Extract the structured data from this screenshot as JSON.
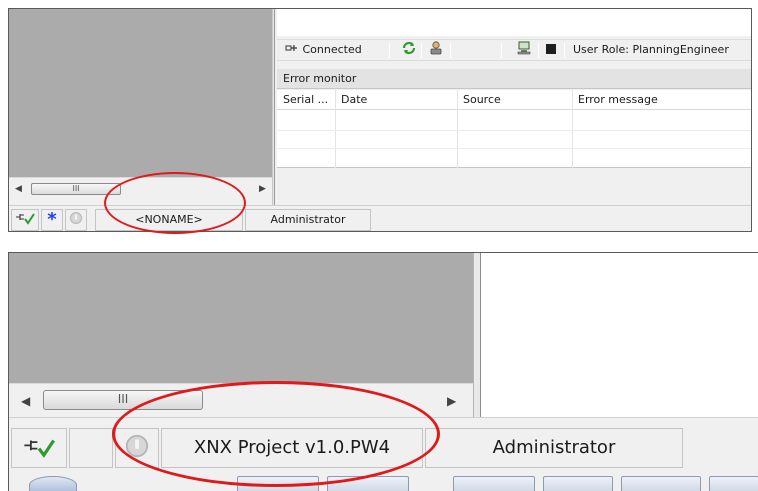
{
  "top": {
    "scroll_thumb": "III",
    "toolbar": {
      "connected_label": "Connected",
      "user_role": "User Role: PlanningEngineer"
    },
    "error_monitor": {
      "title": "Error monitor",
      "columns": [
        "Serial ...",
        "Date",
        "Source",
        "Error message"
      ]
    },
    "status": {
      "project": "<NONAME>",
      "user": "Administrator"
    }
  },
  "bottom": {
    "scroll_thumb": "III",
    "status": {
      "project": "XNX Project v1.0.PW4",
      "user": "Administrator"
    }
  },
  "colors": {
    "highlight": "#e0191b",
    "panel_gray": "#ababab",
    "chrome": "#f0f0f0",
    "star_blue": "#1a3cff",
    "check_green": "#2f9a2f"
  },
  "icons": [
    "connection-plug-check-icon",
    "star-icon",
    "disabled-circle-icon",
    "refresh-icon",
    "user-icon",
    "network-computer-icon",
    "stop-square-icon"
  ]
}
